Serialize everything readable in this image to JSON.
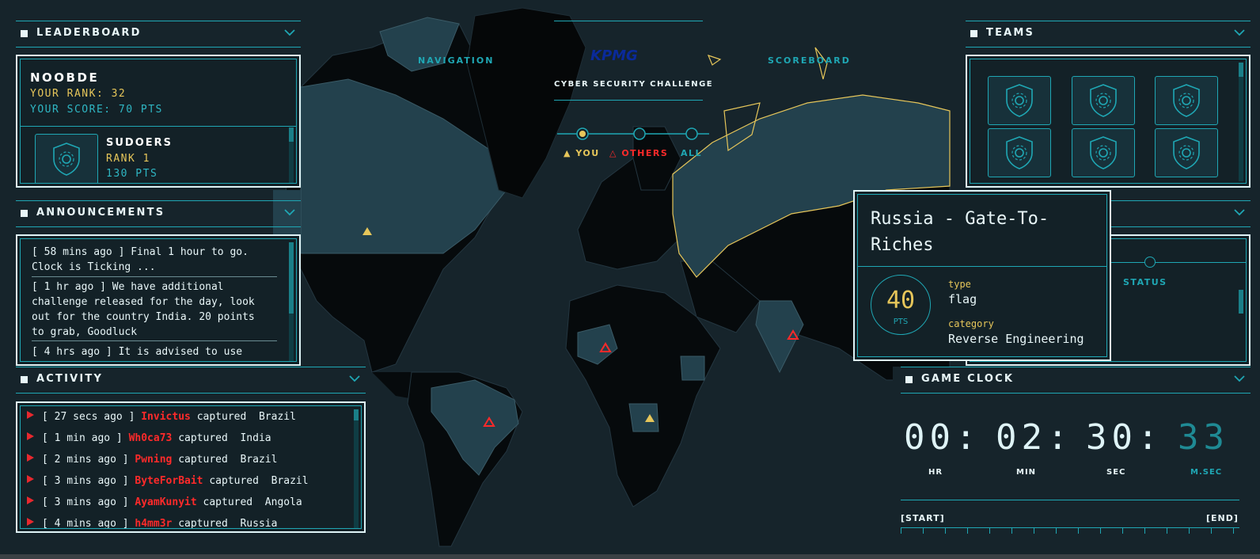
{
  "colors": {
    "accent": "#1fa7b4",
    "gold": "#e6c65a",
    "red": "#ff2a2a",
    "panel": "#132127",
    "highlight_country": "#e6c65a"
  },
  "header": {
    "nav_label": "NAVIGATION",
    "scoreboard_label": "SCOREBOARD",
    "logo_text": "KPMG",
    "subtitle": "CYBER SECURITY CHALLENGE",
    "filters": {
      "you": "YOU",
      "others": "OTHERS",
      "all": "ALL"
    }
  },
  "leaderboard": {
    "title": "LEADERBOARD",
    "user_name": "NOOBDE",
    "user_rank": "YOUR RANK: 32",
    "user_score": "YOUR SCORE: 70  PTS",
    "teams": [
      {
        "name": "SUDOERS",
        "rank": "RANK 1",
        "pts": "130 PTS",
        "icon": "shield-gear-icon"
      }
    ]
  },
  "announcements": {
    "title": "ANNOUNCEMENTS",
    "items": [
      {
        "text": "[ 58 mins ago ] Final 1 hour to go. Clock is Ticking ..."
      },
      {
        "text": "[ 1 hr ago ] We have additional challenge released for the day, look out for the country India. 20 points to grab, Goodluck"
      },
      {
        "text": "[ 4 hrs ago ] It is advised to use"
      }
    ]
  },
  "activity": {
    "title": "ACTIVITY",
    "verb": "captured",
    "items": [
      {
        "time": "[ 27 secs ago ]",
        "who": "Invictus",
        "country": "Brazil"
      },
      {
        "time": "[ 1 min ago ]",
        "who": "Wh0ca73",
        "country": "India"
      },
      {
        "time": "[ 2 mins ago ]",
        "who": "Pwning",
        "country": "Brazil"
      },
      {
        "time": "[ 3 mins ago ]",
        "who": "ByteForBait",
        "country": "Brazil"
      },
      {
        "time": "[ 3 mins ago ]",
        "who": "AyamKunyit",
        "country": "Angola"
      },
      {
        "time": "[ 4 mins ago ]",
        "who": "h4mm3r",
        "country": "Russia"
      }
    ]
  },
  "teams_panel": {
    "title": "TEAMS",
    "icon": "shield-gear-icon",
    "tile_count": 6
  },
  "status_panel": {
    "label": "STATUS"
  },
  "tooltip": {
    "title": "Russia - Gate-To-Riches",
    "points": "40",
    "points_unit": "PTS",
    "type_label": "type",
    "type_value": "flag",
    "category_label": "category",
    "category_value": "Reverse Engineering"
  },
  "game_clock": {
    "title": "GAME CLOCK",
    "hr": "00:",
    "min": "02:",
    "sec": "30:",
    "msec": "33",
    "labels": {
      "hr": "HR",
      "min": "MIN",
      "sec": "SEC",
      "msec": "M.SEC"
    },
    "start_label": "[START]",
    "end_label": "[END]"
  }
}
